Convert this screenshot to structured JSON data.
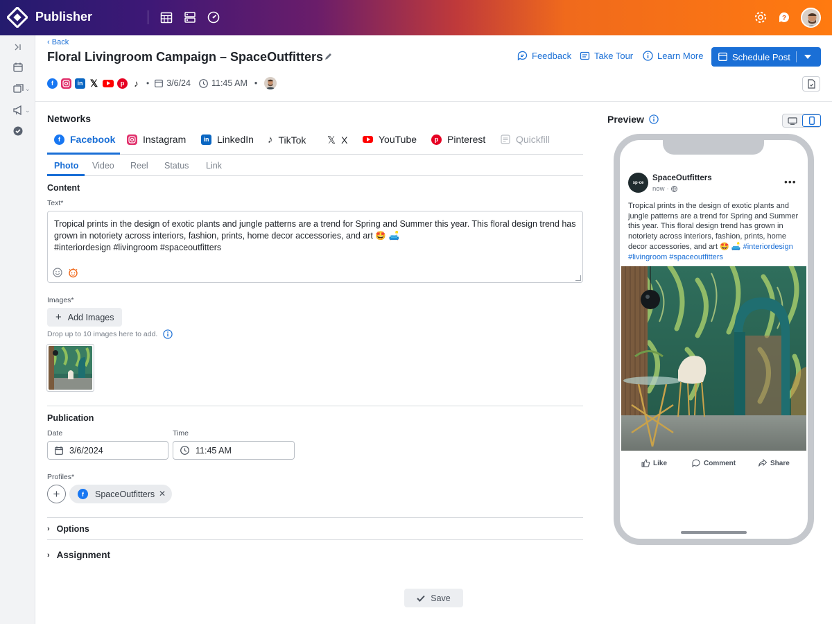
{
  "app": {
    "brand": "Publisher"
  },
  "header": {
    "back_label": "Back",
    "title": "Floral Livingroom Campaign – SpaceOutfitters",
    "links": {
      "feedback": "Feedback",
      "take_tour": "Take Tour",
      "learn_more": "Learn More"
    },
    "schedule_label": "Schedule Post",
    "meta": {
      "date": "3/6/24",
      "time": "11:45 AM"
    }
  },
  "networks": {
    "label": "Networks",
    "tabs": [
      "Facebook",
      "Instagram",
      "LinkedIn",
      "TikTok",
      "X",
      "YouTube",
      "Pinterest",
      "Quickfill"
    ],
    "active": "Facebook",
    "subtabs": [
      "Photo",
      "Video",
      "Reel",
      "Status",
      "Link"
    ],
    "active_subtab": "Photo"
  },
  "content": {
    "label": "Content",
    "text_label": "Text*",
    "text_line1": "Tropical prints in the design of exotic plants and jungle patterns are a trend for Spring and Summer this year. This floral design trend has",
    "text_line2": "grown in notoriety across interiors, fashion, prints, home decor accessories, and art 🤩 🛋️",
    "text_line3": "#interiordesign #livingroom #spaceoutfitters",
    "images_label": "Images*",
    "add_images": "Add Images",
    "drop_hint": "Drop up to 10 images here to add."
  },
  "publication": {
    "label": "Publication",
    "date_label": "Date",
    "date_value": "3/6/2024",
    "time_label": "Time",
    "time_value": "11:45 AM",
    "profiles_label": "Profiles*",
    "profile_chip": "SpaceOutfitters"
  },
  "sections": {
    "options": "Options",
    "assignment": "Assignment"
  },
  "footer": {
    "save_label": "Save"
  },
  "preview": {
    "label": "Preview",
    "account": "SpaceOutfitters",
    "avatar_text": "sp·ce",
    "time": "now",
    "text": "Tropical prints in the design of exotic plants and jungle patterns are a trend for Spring and Summer this year. This floral design trend has grown in notoriety across interiors, fashion, prints, home decor accessories, and art 🤩 🛋️",
    "hashtags": "#interiordesign #livingroom #spaceoutfitters",
    "actions": {
      "like": "Like",
      "comment": "Comment",
      "share": "Share"
    }
  },
  "colors": {
    "accent": "#1a6fd6",
    "facebook": "#1877f2",
    "instagram": "#e1306c",
    "linkedin": "#0a66c2",
    "youtube": "#ff0000",
    "pinterest": "#e60023"
  }
}
